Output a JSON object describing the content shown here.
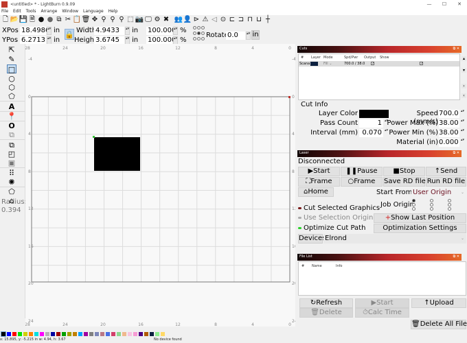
{
  "window": {
    "title": "<untitled> * - LightBurn 0.9.09",
    "controls": [
      "minimize",
      "maximize",
      "close"
    ]
  },
  "menu": [
    "File",
    "Edit",
    "Tools",
    "Arrange",
    "Window",
    "Language",
    "Help"
  ],
  "toolbar": {
    "icons": [
      "new-file-icon",
      "open-folder-icon",
      "save-icon",
      "save-as-icon",
      "import-icon",
      "export-icon",
      "copy-icon",
      "cut-icon",
      "paste-icon",
      "delete-icon",
      "move-icon",
      "zoom-in-icon",
      "zoom-icon",
      "zoom-out-icon",
      "select-frame-icon",
      "camera-icon",
      "monitor-icon",
      "settings-icon",
      "tools-icon",
      "group-icon",
      "ungroup-icon",
      "flip-horizontal-icon",
      "flip-vertical-icon",
      "mirror-icon",
      "target-icon",
      "align-left-icon",
      "align-right-icon",
      "align-top-icon",
      "align-center-icon",
      "distribute-icon"
    ]
  },
  "properties": {
    "xpos_label": "XPos",
    "xpos_value": "18.4986",
    "ypos_label": "YPos",
    "ypos_value": "6.2713",
    "width_label": "Width",
    "width_value": "4.9433",
    "height_label": "Height",
    "height_value": "3.6745",
    "unit": "in",
    "scale_x": "100.000",
    "scale_y": "100.000",
    "percent": "%",
    "rotate_label": "Rotate",
    "rotate_value": "0.0",
    "unit_button": "in"
  },
  "left_tools": {
    "icons": [
      "select-arrow-icon",
      "pen-icon",
      "rectangle-icon",
      "ellipse-icon",
      "polygon-icon",
      "edit-nodes-icon",
      "text-icon",
      "position-marker-icon",
      "offset-icon",
      "weld-icon",
      "boolean-union-icon",
      "boolean-subtract-icon",
      "boolean-intersect-icon",
      "grid-array-icon",
      "circular-array-icon",
      "fillet-icon",
      "chamfer-icon"
    ],
    "selected": "rectangle-icon",
    "radius_label": "Radius:",
    "radius_value": "0.394"
  },
  "canvas": {
    "x_ruler_labels": [
      "28",
      "24",
      "20",
      "16",
      "12",
      "8",
      "4",
      "0"
    ],
    "y_ruler_labels": [
      "-4",
      "0",
      "4",
      "8",
      "12",
      "16",
      "20",
      "24"
    ],
    "bottom_ruler_labels": [
      "28",
      "24",
      "20",
      "16",
      "12",
      "8",
      "4",
      "0"
    ]
  },
  "palette": [
    "#000000",
    "#0000ff",
    "#ff0000",
    "#00e000",
    "#d0d000",
    "#ff8000",
    "#00e0e0",
    "#ff00ff",
    "#b4b4b4",
    "#0000a0",
    "#a00000",
    "#00a000",
    "#a0a000",
    "#c08000",
    "#00a0ff",
    "#a000a0",
    "#808080",
    "#7d87b9",
    "#bb7784",
    "#4a6fe3",
    "#d33f6a",
    "#8cd78f",
    "#f0b98d",
    "#f6c4e1",
    "#f79cd4",
    "#4b0082",
    "#b05a00",
    "#0d2140",
    "#8fef8f",
    "#ffd966"
  ],
  "status": {
    "coords": "x: 15.895, y: -5.215 in  w: 4.94,  h: 3.67",
    "device": "No device found"
  },
  "cuts": {
    "title": "Cuts",
    "headers": [
      "#",
      "Layer",
      "Mode",
      "Spd/Pwr",
      "Output",
      "Show"
    ],
    "rows": [
      {
        "num": "Scana",
        "layer_color": "#0d2140",
        "mode": "Fill",
        "spd_pwr": "700.0 / 38.0",
        "output": true,
        "show": true
      }
    ],
    "scroll_buttons": [
      "^",
      "v",
      ">",
      "<"
    ]
  },
  "cut_info": {
    "title": "Cut Info",
    "layer_color_label": "Layer Color",
    "layer_color": "#000000",
    "pass_count_label": "Pass Count",
    "pass_count": "1",
    "interval_label": "Interval (mm)",
    "interval": "0.070",
    "speed_label": "Speed (mm/s)",
    "speed": "700.0",
    "power_max_label": "Power Max (%)",
    "power_max": "38.00",
    "power_min_label": "Power Min (%)",
    "power_min": "38.00",
    "material_label": "Material (in)",
    "material": "0.000"
  },
  "laser": {
    "title": "Laser",
    "status": "Disconnected",
    "buttons": {
      "start": "▶Start",
      "pause": "❚❚Pause",
      "stop": "■Stop",
      "send": "↑Send",
      "frame1": "⛶Frame",
      "frame2": "○Frame",
      "save_rd": "Save RD file",
      "run_rd": "Run RD file",
      "home": "⌂Home",
      "show_last": "Show Last Position",
      "optimization": "Optimization Settings"
    },
    "start_from_label": "Start From:",
    "start_from_value": "User Origin",
    "job_origin_label": "Job Origin",
    "cut_selected": "Cut Selected Graphics",
    "use_selection_origin": "Use Selection Origin",
    "optimize_cut_path": "Optimize Cut Path",
    "devices_label": "Devices",
    "device_value": "Elrond"
  },
  "file_list": {
    "title": "File List",
    "headers": [
      "#",
      "Name",
      "Info"
    ],
    "buttons": {
      "refresh": "↻Refresh",
      "start": "▶Start",
      "upload": "↑Upload",
      "delete": "🗑Delete",
      "calc_time": "⏱Calc Time",
      "delete_all": "🗑Delete All Files"
    }
  }
}
